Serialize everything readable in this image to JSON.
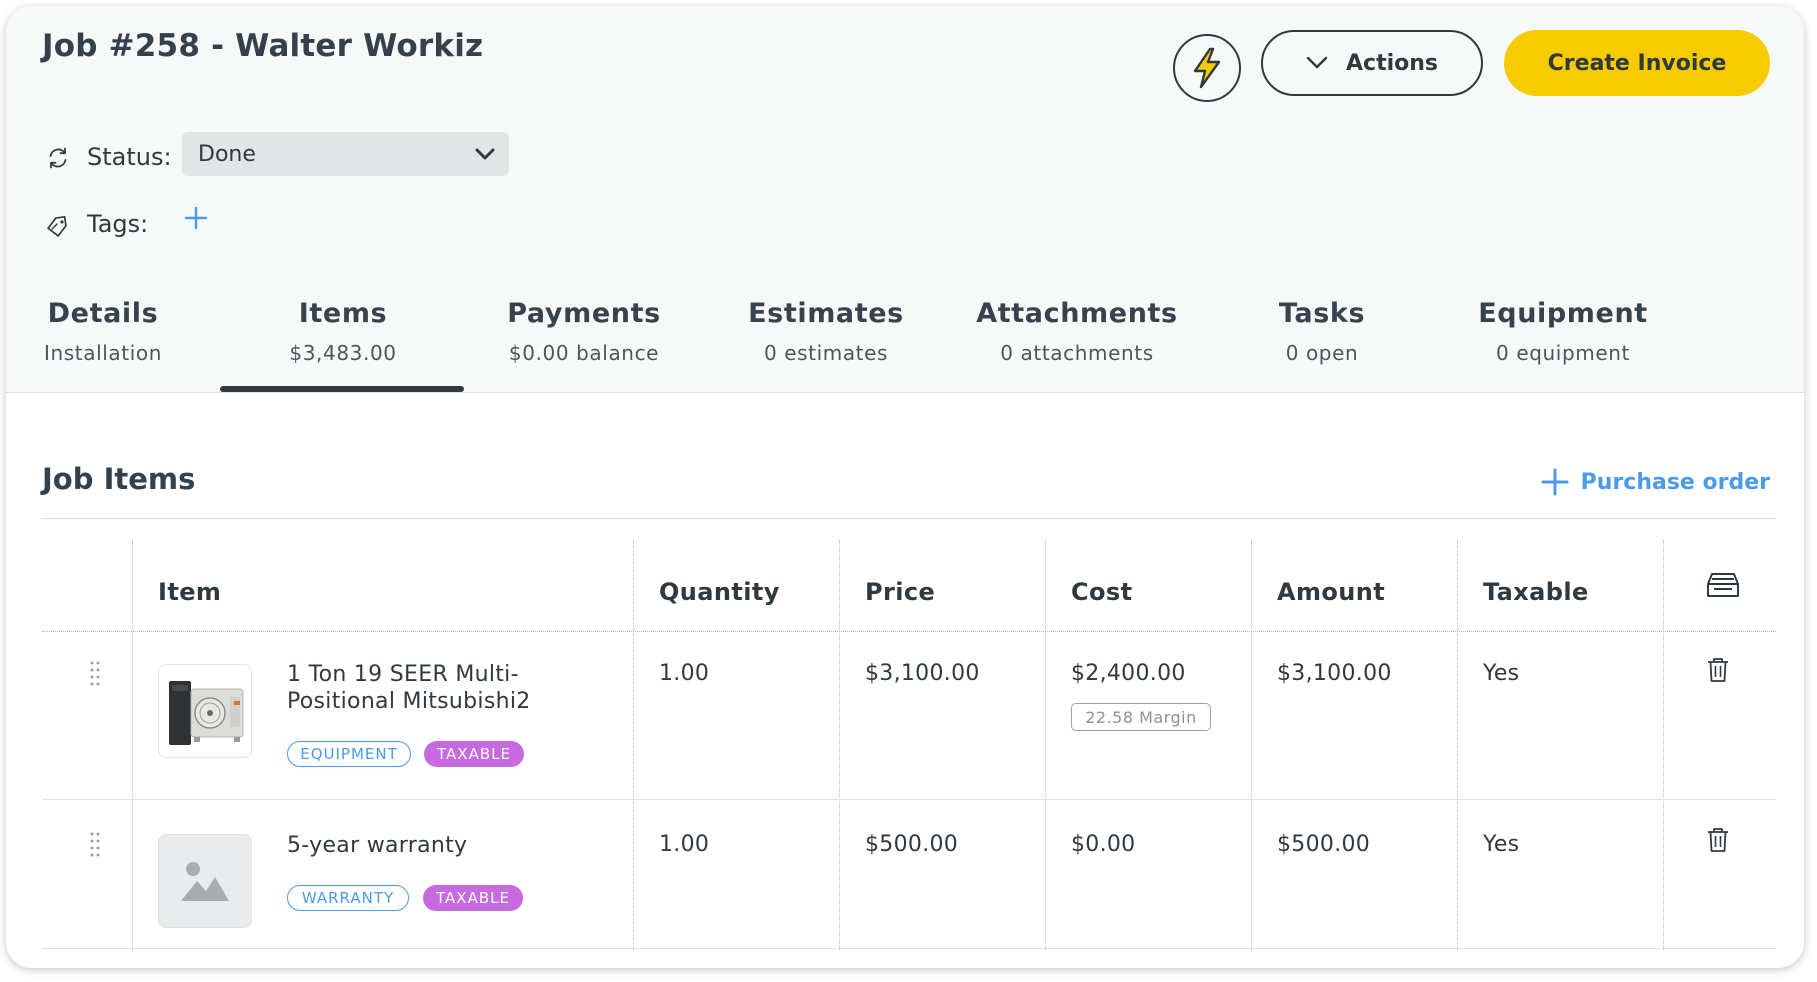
{
  "header": {
    "title": "Job #258 - Walter Workiz",
    "actions_label": "Actions",
    "create_invoice_label": "Create Invoice"
  },
  "status": {
    "label": "Status:",
    "value": "Done"
  },
  "tags": {
    "label": "Tags:"
  },
  "tabs": [
    {
      "label": "Details",
      "sub": "Installation"
    },
    {
      "label": "Items",
      "sub": "$3,483.00"
    },
    {
      "label": "Payments",
      "sub": "$0.00 balance"
    },
    {
      "label": "Estimates",
      "sub": "0 estimates"
    },
    {
      "label": "Attachments",
      "sub": "0 attachments"
    },
    {
      "label": "Tasks",
      "sub": "0 open"
    },
    {
      "label": "Equipment",
      "sub": "0 equipment"
    }
  ],
  "active_tab": "Items",
  "section": {
    "title": "Job Items",
    "purchase_order_label": "Purchase order"
  },
  "table": {
    "headers": [
      "Item",
      "Quantity",
      "Price",
      "Cost",
      "Amount",
      "Taxable"
    ],
    "rows": [
      {
        "name": "1 Ton 19 SEER Multi-Positional Mitsubishi2",
        "tags": [
          "EQUIPMENT",
          "TAXABLE"
        ],
        "quantity": "1.00",
        "price": "$3,100.00",
        "cost": "$2,400.00",
        "margin": "22.58 Margin",
        "amount": "$3,100.00",
        "taxable": "Yes",
        "image": "hvac-unit"
      },
      {
        "name": "5-year warranty",
        "tags": [
          "WARRANTY",
          "TAXABLE"
        ],
        "quantity": "1.00",
        "price": "$500.00",
        "cost": "$0.00",
        "amount": "$500.00",
        "taxable": "Yes",
        "image": "image-placeholder"
      }
    ]
  },
  "colors": {
    "accent_yellow": "#f6cc00",
    "link_blue": "#4a9bea",
    "taxable_badge": "#c76ae0",
    "text_dark": "#2f3941",
    "header_bg": "#f7f8f8"
  },
  "icons": [
    "lightning-bolt-icon",
    "chevron-down-icon",
    "refresh-icon",
    "tag-icon",
    "plus-icon",
    "archive-icon",
    "drag-handle-icon",
    "trash-icon",
    "image-placeholder-icon"
  ]
}
